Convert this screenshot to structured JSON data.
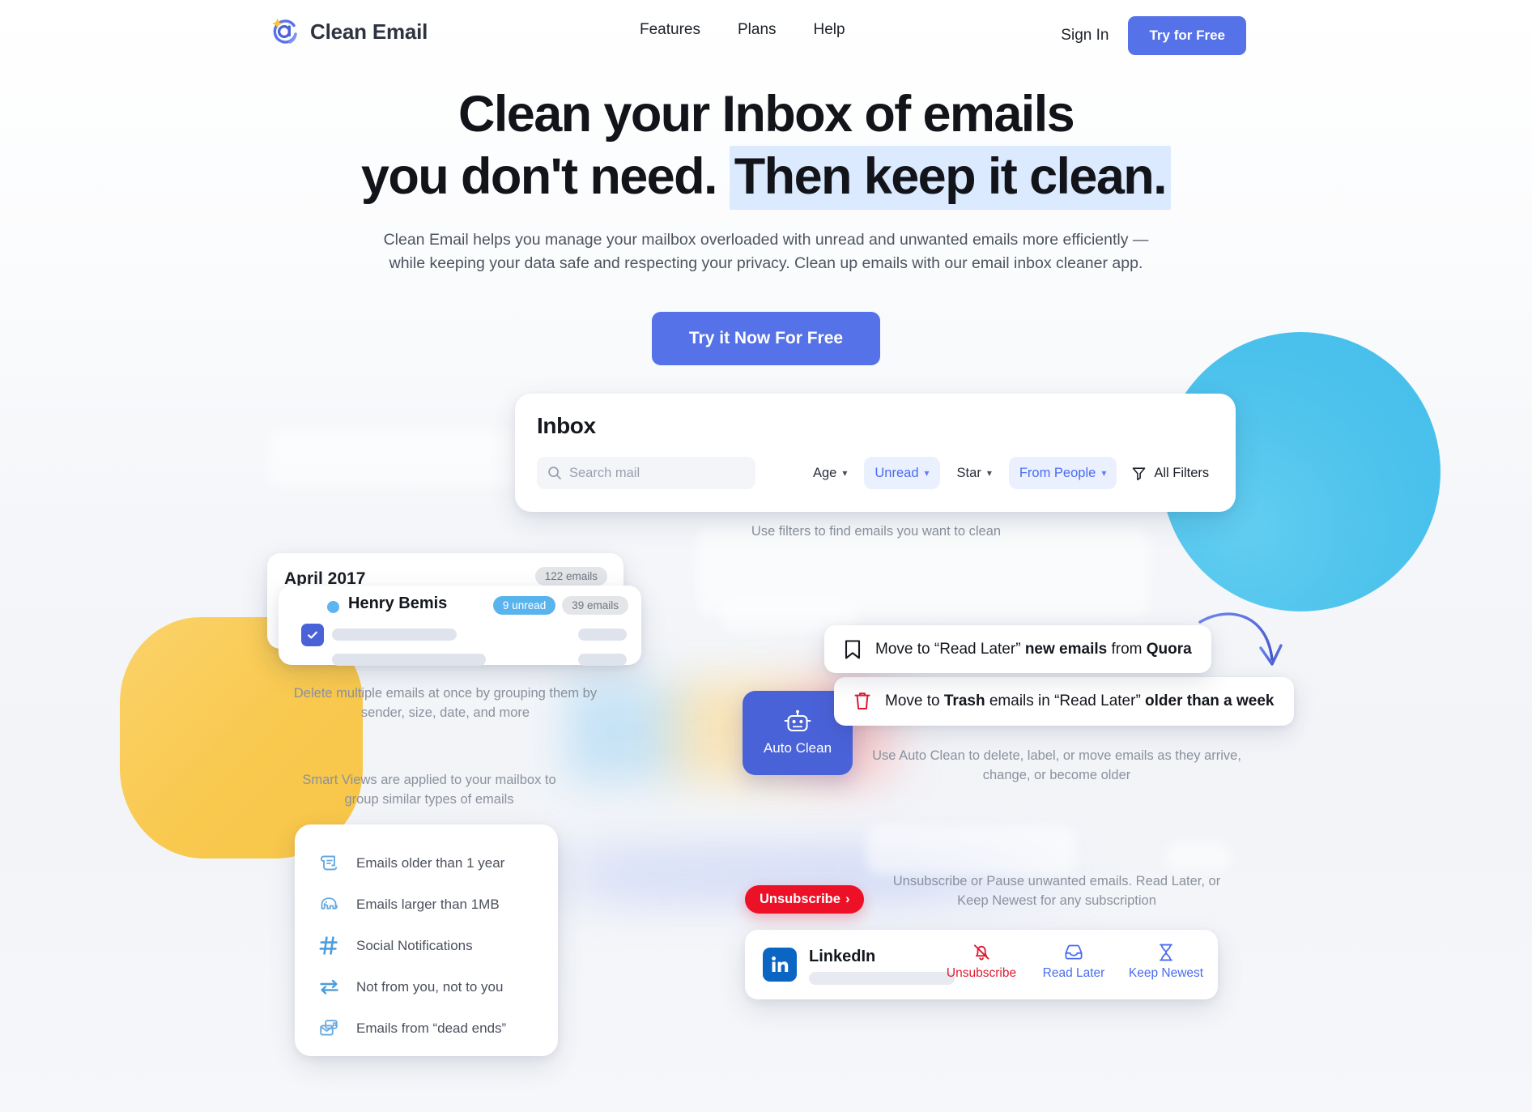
{
  "header": {
    "brand": "Clean Email",
    "nav": [
      {
        "label": "Features"
      },
      {
        "label": "Plans"
      },
      {
        "label": "Help"
      }
    ],
    "sign_in": "Sign In",
    "try_free": "Try for Free"
  },
  "hero": {
    "headline_line1": "Clean your Inbox of emails",
    "headline_line2_plain": "you don't need.",
    "headline_line2_highlight": "Then keep it clean.",
    "subtitle_line1": "Clean Email helps you manage your mailbox overloaded with unread and unwanted emails more efficiently —",
    "subtitle_line2": "while keeping your data safe and respecting your privacy. Clean up emails with our email inbox cleaner app.",
    "cta": "Try it Now For Free"
  },
  "inbox": {
    "title": "Inbox",
    "search_placeholder": "Search mail",
    "filters": [
      {
        "label": "Age",
        "active": false
      },
      {
        "label": "Unread",
        "active": true
      },
      {
        "label": "Star",
        "active": false
      },
      {
        "label": "From People",
        "active": true
      }
    ],
    "all_filters": "All Filters",
    "caption": "Use filters to find emails you want to clean"
  },
  "group": {
    "month": "April 2017",
    "month_count": "122 emails",
    "sender": "Henry Bemis",
    "sender_unread": "9 unread",
    "sender_count": "39 emails",
    "caption_line1": "Delete multiple emails at once by grouping them by",
    "caption_line2": "sender, size, date, and more"
  },
  "smart_views": {
    "caption_line1": "Smart Views are applied to your mailbox to",
    "caption_line2": "group similar types of emails",
    "items": [
      {
        "label": "Emails older than 1 year",
        "icon": "scroll-icon"
      },
      {
        "label": "Emails larger than 1MB",
        "icon": "elephant-icon"
      },
      {
        "label": "Social Notifications",
        "icon": "hash-icon"
      },
      {
        "label": "Not from you, not to you",
        "icon": "exchange-arrows-icon"
      },
      {
        "label": "Emails from “dead ends”",
        "icon": "envelope-stack-icon"
      }
    ]
  },
  "auto_clean": {
    "button_label": "Auto Clean",
    "rule1_pre": "Move to “Read Later” ",
    "rule1_b1": "new emails",
    "rule1_mid": " from ",
    "rule1_b2": "Quora",
    "rule2_pre": "Move to ",
    "rule2_b1": "Trash",
    "rule2_mid": " emails in “Read Later” ",
    "rule2_b2": "older than a week",
    "caption_line1": "Use Auto Clean to delete, label, or move emails as they arrive,",
    "caption_line2": "change, or become older"
  },
  "unsubscribe": {
    "pill": "Unsubscribe",
    "pill_chevron": "›",
    "caption_line1": "Unsubscribe or Pause unwanted emails. Read Later, or",
    "caption_line2": "Keep Newest for any subscription",
    "sender": "LinkedIn",
    "actions": [
      {
        "label": "Unsubscribe",
        "icon": "bell-muted-icon",
        "color": "#e01a32"
      },
      {
        "label": "Read Later",
        "icon": "inbox-tray-icon",
        "color": "#4a6cf0"
      },
      {
        "label": "Keep Newest",
        "icon": "hourglass-icon",
        "color": "#4a6cf0"
      }
    ]
  },
  "colors": {
    "brand_blue": "#5672e8",
    "accent_cyan": "#4cc2ec",
    "accent_yellow": "#f9c94f",
    "highlight_bg": "#dbeafe",
    "danger_red": "#ec1127",
    "chip_active_bg": "#eaf0fe"
  }
}
